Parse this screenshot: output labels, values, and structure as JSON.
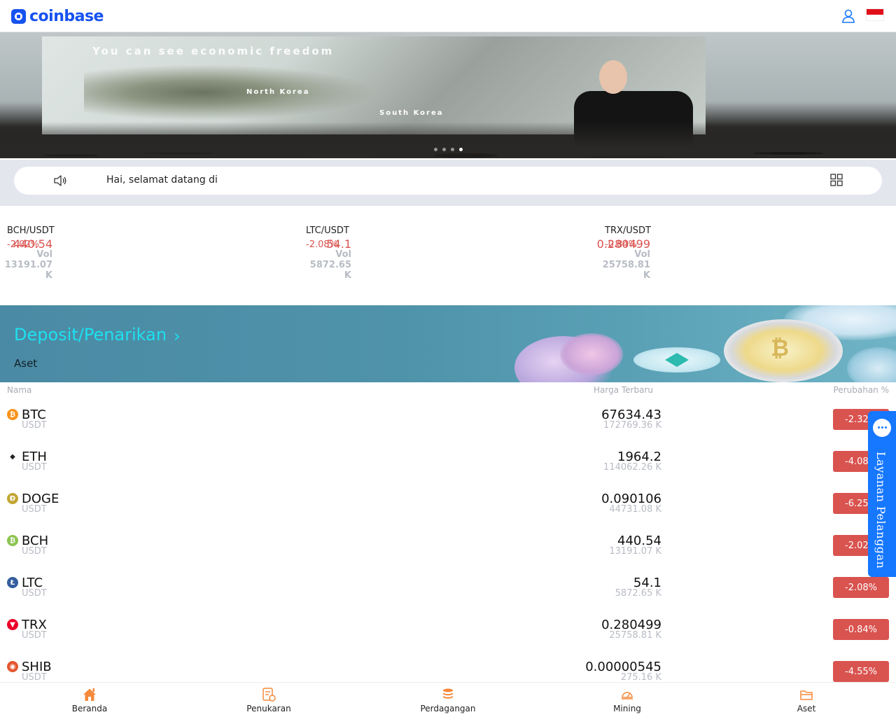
{
  "header": {
    "logo_text": "coinbase"
  },
  "banner": {
    "headline": "You can see economic freedom",
    "label_north": "North Korea",
    "label_south": "South Korea",
    "slide_count": 4,
    "active_slide": 4
  },
  "notice": {
    "text": "Hai, selamat datang di"
  },
  "tickers": [
    {
      "pair": "BCH/USDT",
      "price": "440.54",
      "change": "-2.02%",
      "volume": "Vol 13191.07 K"
    },
    {
      "pair": "LTC/USDT",
      "price": "54.1",
      "change": "-2.08%",
      "volume": "Vol 5872.65 K"
    },
    {
      "pair": "TRX/USDT",
      "price": "0.280499",
      "change": "-0.84%",
      "volume": "Vol 25758.81 K"
    }
  ],
  "deposit": {
    "title": "Deposit/Penarikan",
    "subtitle": "Aset"
  },
  "market": {
    "columns": {
      "name": "Nama",
      "price": "Harga Terbaru",
      "change": "Perubahan %"
    },
    "rows": [
      {
        "symbol": "BTC",
        "quote": "USDT",
        "price": "67634.43",
        "volume": "172769.36 K",
        "change": "-2.32%",
        "icon": "btc-icon",
        "color": "#f7931a",
        "glyph": "₿"
      },
      {
        "symbol": "ETH",
        "quote": "USDT",
        "price": "1964.2",
        "volume": "114062.26 K",
        "change": "-4.08%",
        "icon": "eth-icon",
        "color": "#ffffff",
        "glyph": "◆"
      },
      {
        "symbol": "DOGE",
        "quote": "USDT",
        "price": "0.090106",
        "volume": "44731.08 K",
        "change": "-6.25%",
        "icon": "doge-icon",
        "color": "#c2a633",
        "glyph": "Ð"
      },
      {
        "symbol": "BCH",
        "quote": "USDT",
        "price": "440.54",
        "volume": "13191.07 K",
        "change": "-2.02%",
        "icon": "bch-icon",
        "color": "#8dc351",
        "glyph": "₿"
      },
      {
        "symbol": "LTC",
        "quote": "USDT",
        "price": "54.1",
        "volume": "5872.65 K",
        "change": "-2.08%",
        "icon": "ltc-icon",
        "color": "#345d9d",
        "glyph": "Ł"
      },
      {
        "symbol": "TRX",
        "quote": "USDT",
        "price": "0.280499",
        "volume": "25758.81 K",
        "change": "-0.84%",
        "icon": "trx-icon",
        "color": "#eb0029",
        "glyph": "▼"
      },
      {
        "symbol": "SHIB",
        "quote": "USDT",
        "price": "0.00000545",
        "volume": "275.16 K",
        "change": "-4.55%",
        "icon": "shib-icon",
        "color": "#e4572e",
        "glyph": "◉"
      }
    ]
  },
  "customer_service": {
    "label": "Layanan Pelanggan"
  },
  "nav": [
    {
      "label": "Beranda",
      "icon": "home-icon"
    },
    {
      "label": "Penukaran",
      "icon": "exchange-icon"
    },
    {
      "label": "Perdagangan",
      "icon": "trade-icon"
    },
    {
      "label": "Mining",
      "icon": "mining-icon"
    },
    {
      "label": "Aset",
      "icon": "wallet-icon"
    }
  ],
  "colors": {
    "brand": "#1652f0",
    "negative": "#d9534f",
    "accent_orange": "#f58a3c",
    "deposit_title": "#1ee0f0",
    "service_blue": "#1677ff"
  }
}
